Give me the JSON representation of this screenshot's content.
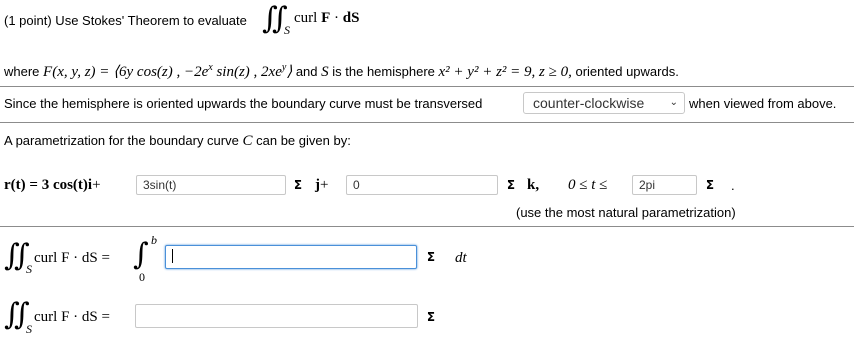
{
  "problem": {
    "points": "(1 point) Use Stokes' Theorem to evaluate",
    "curl_text": "curl",
    "F": "F",
    "dot": "·",
    "dS": "dS",
    "S": "S",
    "where_label": "where",
    "F_def": "F(x, y, z) = ⟨6y cos(z) , −2e",
    "F_sup1": "x",
    "F_mid": " sin(z) , 2xe",
    "F_sup2": "y",
    "F_end": "⟩",
    "and_label": "and",
    "S_var": "S",
    "is_label": "is the hemisphere",
    "hemi_eq": "x² + y² + z² = 9,  z ≥ 0,",
    "oriented": "oriented upwards."
  },
  "orientation": {
    "prefix": "Since the hemisphere is oriented upwards the boundary curve must be transversed",
    "selected": "counter-clockwise",
    "suffix": "when viewed from above."
  },
  "param": {
    "intro": "A parametrization for the boundary curve",
    "C": "C",
    "intro_end": "can be given by:",
    "r_label": "r(t) = 3 cos(t)",
    "i": "i",
    "plus1": "+",
    "x_value": "3sin(t)",
    "j": "j",
    "plus2": "+",
    "z_value": "0",
    "k": "k,",
    "t_range": "0 ≤ t ≤",
    "t_upper": "2pi",
    "period": ".",
    "note": "(use the most natural parametrization)"
  },
  "integrals": {
    "eq1_label": "curl F · dS =",
    "lower": "0",
    "upper": "b",
    "integrand_value": "",
    "dt": "dt",
    "eq2_label": "curl F · dS =",
    "answer_value": ""
  },
  "icons": {
    "sigma": "Σ",
    "chevron": "⌄"
  }
}
